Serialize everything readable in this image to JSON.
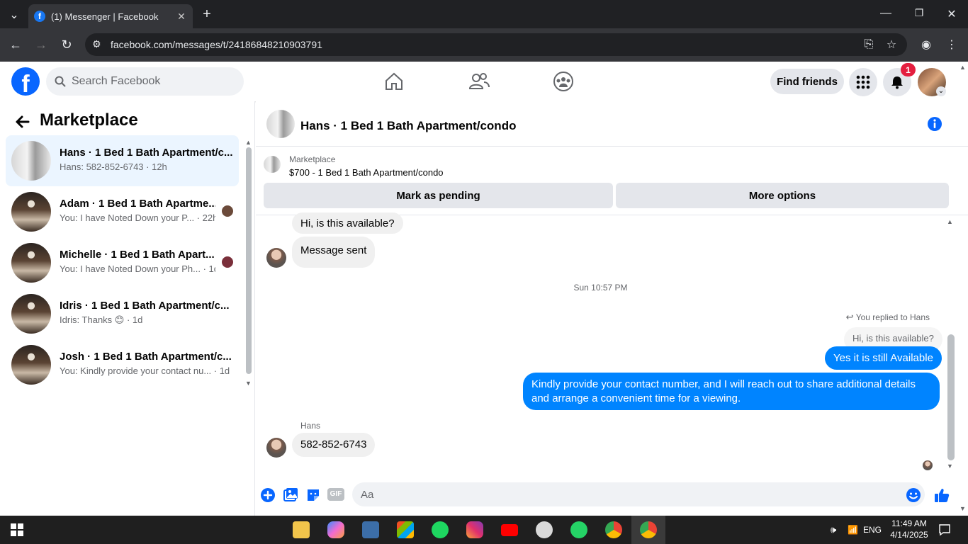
{
  "browser": {
    "tab_title": "(1) Messenger | Facebook",
    "url": "facebook.com/messages/t/24186848210903791"
  },
  "header": {
    "search_placeholder": "Search Facebook",
    "find_friends": "Find friends",
    "notification_count": "1"
  },
  "sidebar": {
    "title": "Marketplace",
    "conversations": [
      {
        "name": "Hans · 1 Bed 1 Bath Apartment/c...",
        "snippet": "Hans: 582-852-6743 · 12h"
      },
      {
        "name": "Adam · 1 Bed 1 Bath Apartme...",
        "snippet": "You: I have Noted Down your P... · 22h"
      },
      {
        "name": "Michelle · 1 Bed 1 Bath Apart...",
        "snippet": "You: I have Noted Down your Ph... · 1d"
      },
      {
        "name": "Idris · 1 Bed 1 Bath Apartment/c...",
        "snippet": "Idris: Thanks 😊 · 1d"
      },
      {
        "name": "Josh · 1 Bed 1 Bath Apartment/c...",
        "snippet": "You: Kindly provide your contact nu... · 1d"
      }
    ]
  },
  "chat": {
    "title": "Hans · 1 Bed 1 Bath Apartment/condo",
    "marketplace_label": "Marketplace",
    "listing": "$700 - 1 Bed 1 Bath Apartment/condo",
    "mark_pending": "Mark as pending",
    "more_options": "More options",
    "messages": {
      "m1": "Hi, is this available?",
      "m2": "Message sent",
      "timestamp": "Sun 10:57 PM",
      "replied_to": "You replied to Hans",
      "quoted": "Hi, is this available?",
      "out1": "Yes it is still Available",
      "out2": "Kindly provide your contact number, and I will reach out to share additional details and arrange a convenient time for a viewing.",
      "sender": "Hans",
      "in_last": "582-852-6743"
    },
    "composer_placeholder": "Aa"
  },
  "taskbar": {
    "lang": "ENG",
    "time": "11:49 AM",
    "date": "4/14/2025"
  },
  "colors": {
    "fb_blue": "#0866ff",
    "outgoing_bubble": "#0084ff",
    "active_conv": "#ebf5ff"
  }
}
